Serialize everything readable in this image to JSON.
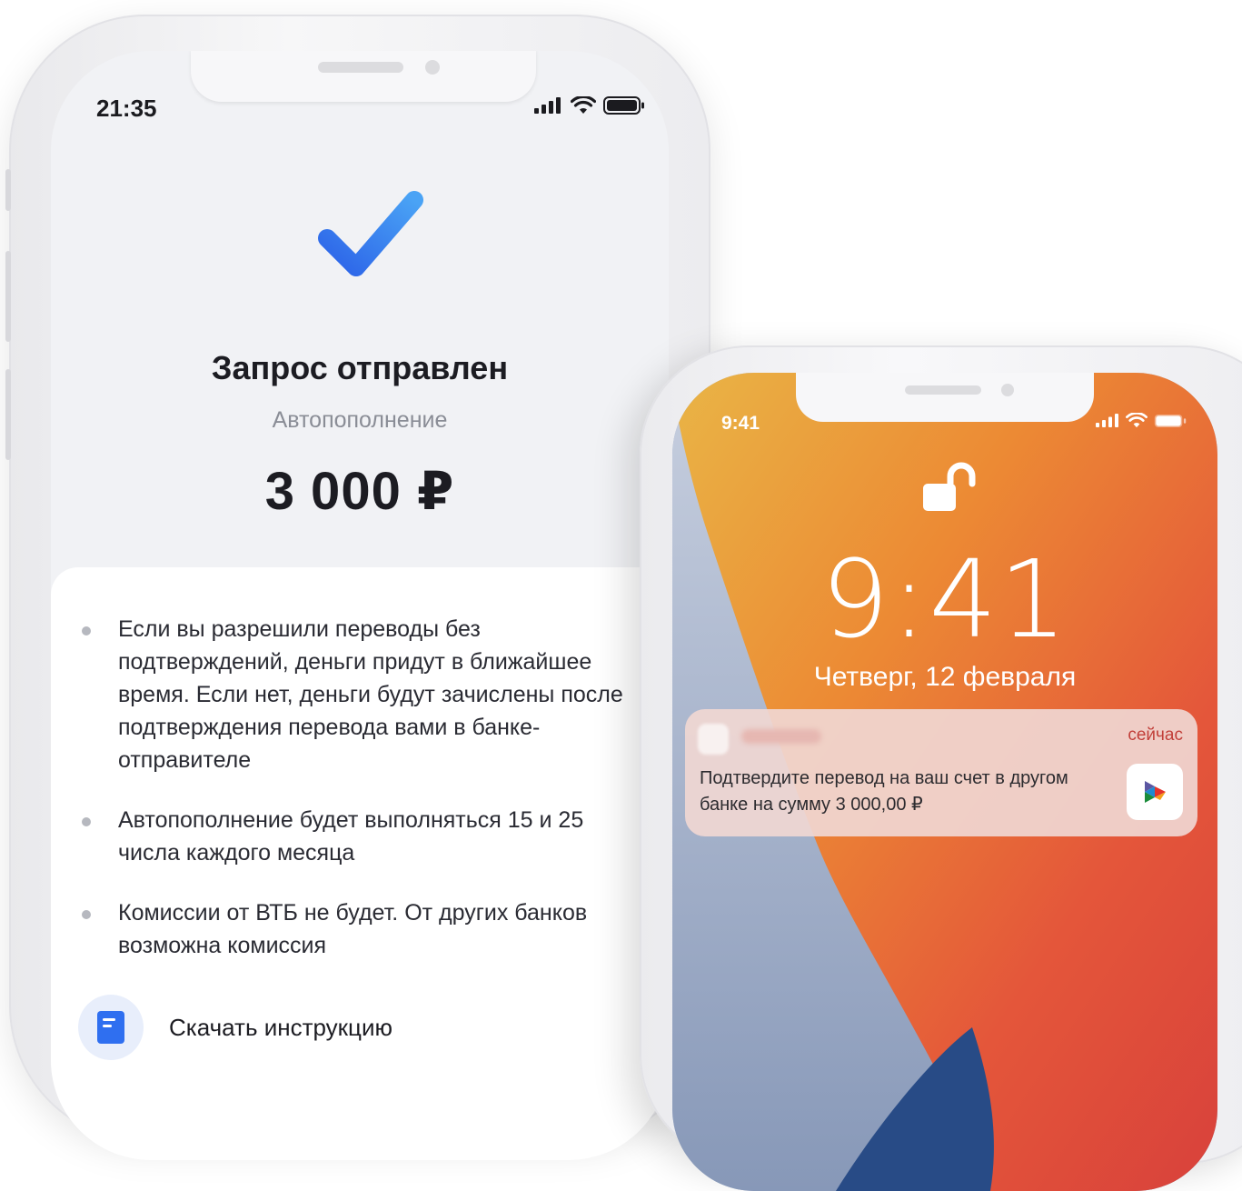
{
  "left_phone": {
    "status_time": "21:35",
    "title": "Запрос отправлен",
    "subtitle": "Автопополнение",
    "amount": "3 000 ₽",
    "bullets": [
      "Если вы разрешили переводы без подтверждений, деньги придут в ближайшее время. Если нет, деньги будут зачислены после подтверждения перевода вами в банке-отправителе",
      "Автопополнение будет выполняться 15 и 25 числа каждого месяца",
      "Комиссии от ВТБ не будет. От других банков возможна комиссия"
    ],
    "download_label": "Скачать инструкцию",
    "icons": [
      "signal-icon",
      "wifi-icon",
      "battery-icon",
      "checkmark-icon",
      "document-icon"
    ],
    "accent_color": "#2f6ff0"
  },
  "right_phone": {
    "status_time": "9:41",
    "lock_time": "9:41",
    "lock_date": "Четверг, 12 февраля",
    "notification": {
      "time": "сейчас",
      "text": "Подтвердите перевод на ваш счет в другом банке на сумму 3 000,00 ₽"
    },
    "icons": [
      "signal-icon",
      "wifi-icon",
      "battery-icon",
      "unlocked-padlock-icon",
      "sbp-logo-icon"
    ]
  }
}
